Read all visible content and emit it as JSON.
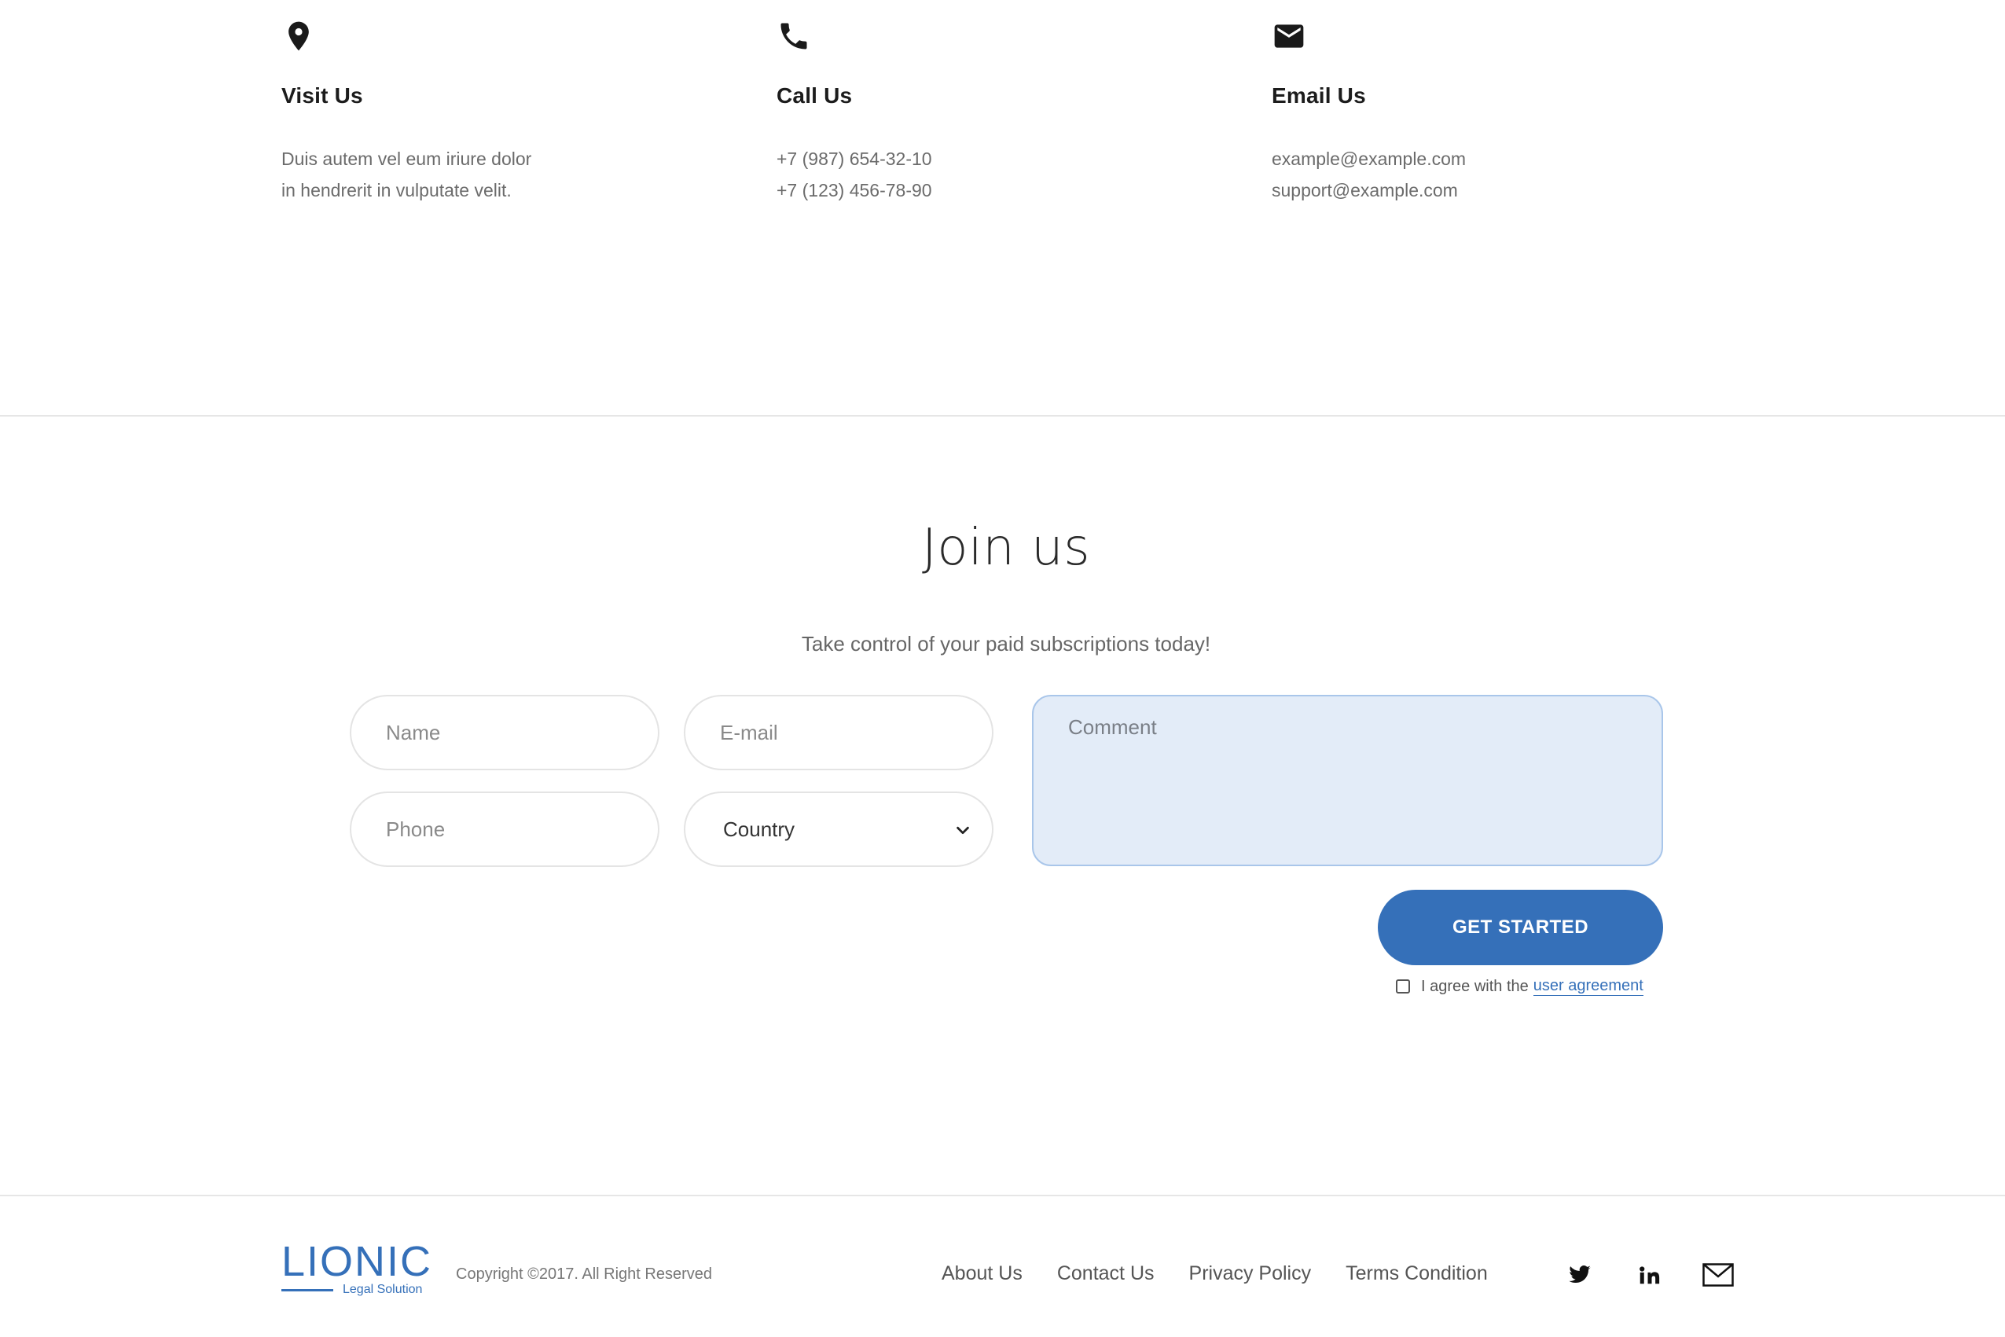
{
  "contacts": {
    "visit": {
      "icon": "map-pin-icon",
      "title": "Visit Us",
      "line1": "Duis autem vel eum iriure dolor",
      "line2": "in hendrerit in vulputate velit."
    },
    "call": {
      "icon": "phone-icon",
      "title": "Call Us",
      "line1": "+7 (987) 654-32-10",
      "line2": "+7 (123) 456-78-90"
    },
    "email": {
      "icon": "envelope-icon",
      "title": "Email Us",
      "line1": "example@example.com",
      "line2": "support@example.com"
    }
  },
  "join": {
    "title": "Join us",
    "subtitle": "Take control of your paid subscriptions today!",
    "form": {
      "name_placeholder": "Name",
      "email_placeholder": "E-mail",
      "phone_placeholder": "Phone",
      "country_selected": "Country",
      "comment_placeholder": "Comment",
      "submit_label": "GET STARTED",
      "agree_text": "I agree with the",
      "agree_link": "user agreement"
    }
  },
  "footer": {
    "logo_name": "LIONIC",
    "logo_tagline": "Legal Solution",
    "copyright": "Copyright ©2017. All Right Reserved",
    "nav": [
      "About Us",
      "Contact Us",
      "Privacy Policy",
      "Terms Condition"
    ],
    "social": [
      "twitter-icon",
      "linkedin-icon",
      "mail-icon"
    ]
  },
  "colors": {
    "accent": "#3570b9",
    "comment_bg": "#e3ecf8",
    "text_muted": "#6b6b6b"
  }
}
